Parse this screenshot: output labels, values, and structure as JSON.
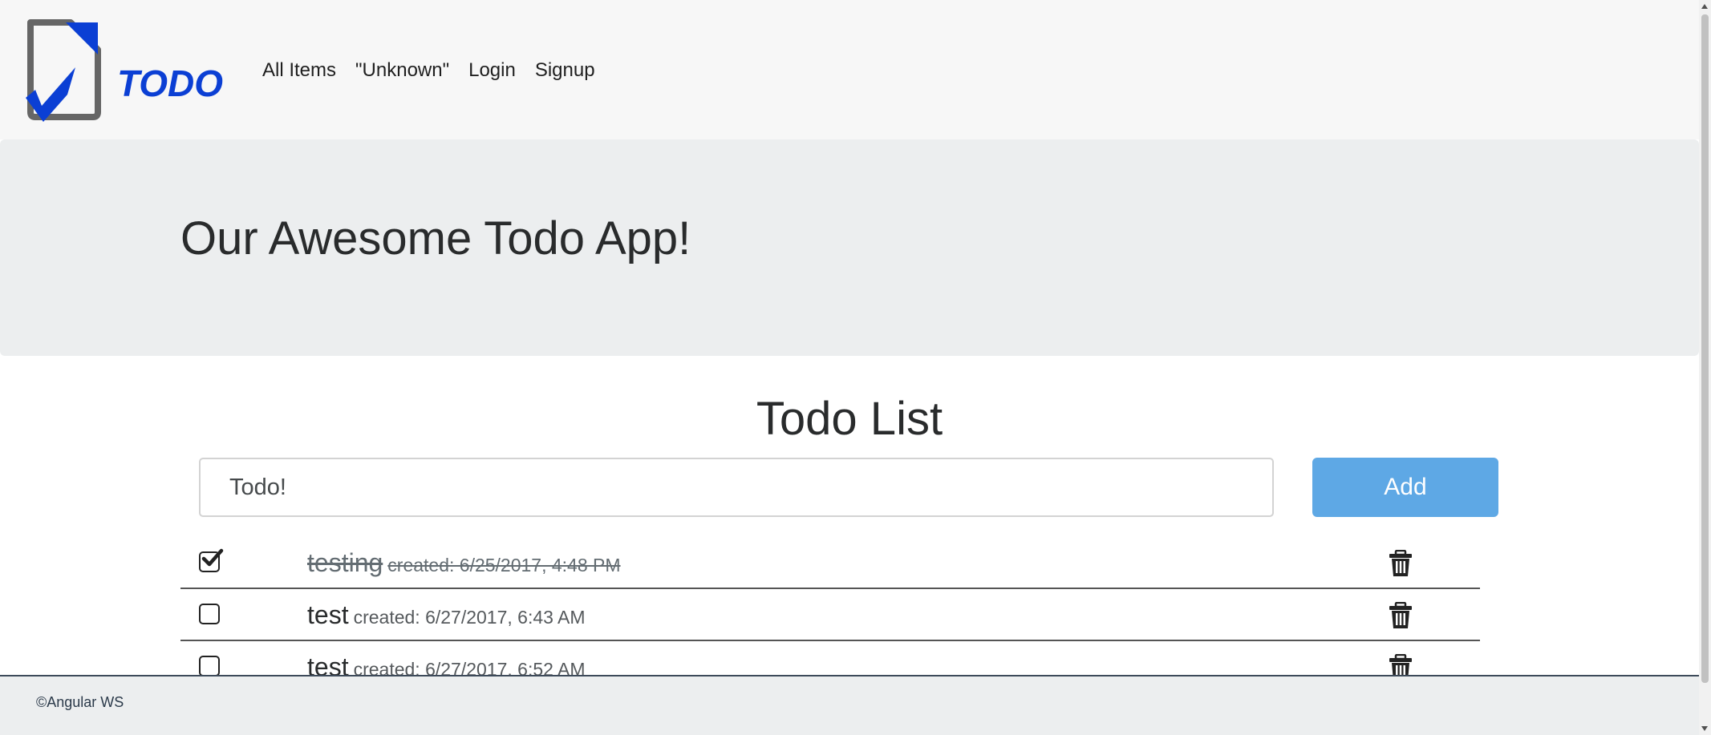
{
  "brand": {
    "logo_text": "TODO"
  },
  "nav": {
    "items": [
      {
        "label": "All Items"
      },
      {
        "label": "\"Unknown\""
      },
      {
        "label": "Login"
      },
      {
        "label": "Signup"
      }
    ]
  },
  "jumbotron": {
    "title": "Our Awesome Todo App!"
  },
  "todo": {
    "heading": "Todo List",
    "input_value": "Todo!",
    "add_label": "Add",
    "items": [
      {
        "title": "testing",
        "created": "created: 6/25/2017, 4:48 PM",
        "completed": true
      },
      {
        "title": "test",
        "created": "created: 6/27/2017, 6:43 AM",
        "completed": false
      },
      {
        "title": "test",
        "created": "created: 6/27/2017, 6:52 AM",
        "completed": false
      }
    ]
  },
  "footer": {
    "text": "©Angular WS"
  },
  "colors": {
    "add_button": "#5ea8e5",
    "brand_blue": "#0b3fd4",
    "jumbotron_bg": "#eceeef",
    "navbar_bg": "#f7f7f7"
  }
}
